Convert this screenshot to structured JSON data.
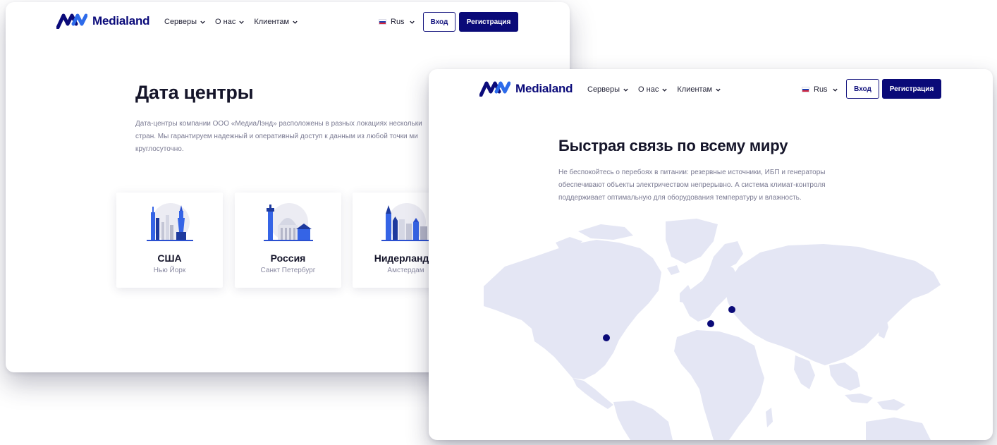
{
  "brand": {
    "name": "Medialand",
    "logo_color": "#0b0b7a",
    "logo_accent": "#2d6bea"
  },
  "nav": {
    "items": [
      {
        "label": "Серверы",
        "icon": "chevron-down-icon"
      },
      {
        "label": "О нас",
        "icon": "chevron-down-icon"
      },
      {
        "label": "Клиентам",
        "icon": "chevron-down-icon"
      }
    ],
    "language": {
      "label": "Rus",
      "flag": "russia-flag-icon"
    },
    "login_label": "Вход",
    "register_label": "Регистрация"
  },
  "colors": {
    "primary": "#0a0a78",
    "accent_blue": "#3564e6",
    "map_land": "#e4e6f4",
    "text_muted": "#7a7a92"
  },
  "datacenters_page": {
    "title": "Дата центры",
    "description": "Дата-центры компании ООО «МедиаЛэнд» расположены в разных локациях нескольки\nстран. Мы гарантируем надежный и оперативный доступ к данным из любой точки ми\nкруглосуточно.",
    "cards": [
      {
        "title": "США",
        "subtitle": "Нью Йорк",
        "icon": "new-york-skyline-icon"
      },
      {
        "title": "Россия",
        "subtitle": "Санкт Петербург",
        "icon": "saint-petersburg-skyline-icon"
      },
      {
        "title": "Нидерланды",
        "subtitle": "Амстердам",
        "icon": "amsterdam-skyline-icon"
      }
    ]
  },
  "connectivity_page": {
    "title": "Быстрая связь по всему миру",
    "description": "Не беспокойтесь о перебоях в питании: резервные источники, ИБП и генераторы\nобеспечивают объекты электричеством непрерывно. А система климат-контроля\nподдерживает оптимальную для оборудования температуру и влажность.",
    "map_markers": [
      "New York",
      "Amsterdam",
      "Saint Petersburg"
    ]
  }
}
